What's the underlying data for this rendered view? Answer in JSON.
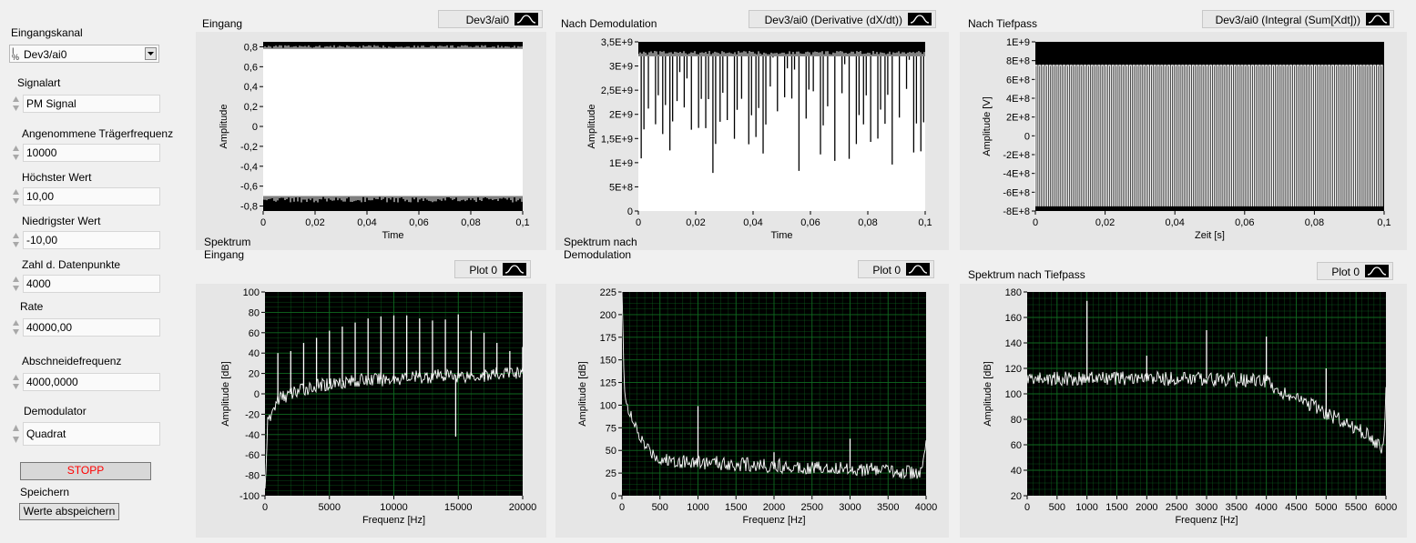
{
  "controls": {
    "channel_label": "Eingangskanal",
    "channel_value": "Dev3/ai0",
    "signal_type_label": "Signalart",
    "signal_type_value": "PM Signal",
    "carrier_label": "Angenommene Trägerfrequenz",
    "carrier_value": "10000",
    "max_label": "Höchster Wert",
    "max_value": "10,00",
    "min_label": "Niedrigster Wert",
    "min_value": "-10,00",
    "points_label": "Zahl d. Datenpunkte",
    "points_value": "4000",
    "rate_label": "Rate",
    "rate_value": "40000,00",
    "cutoff_label": "Abschneidefrequenz",
    "cutoff_value": "4000,0000",
    "demod_label": "Demodulator",
    "demod_value": "Quadrat",
    "stop_label": "STOPP",
    "save_label": "Speichern",
    "save_button": "Werte abspeichern"
  },
  "colors": {
    "plot_bg": "#000000",
    "trace": "#ffffff",
    "grid": "#0f6a20",
    "stop_text": "#ff0000"
  },
  "graphs": [
    {
      "title": "Eingang",
      "legend": "Dev3/ai0",
      "xlabel": "Time",
      "ylabel": "Amplitude",
      "xticks": [
        "0",
        "0,02",
        "0,04",
        "0,06",
        "0,08",
        "0,1"
      ],
      "yticks": [
        "0,8",
        "0,6",
        "0,4",
        "0,2",
        "0",
        "-0,2",
        "-0,4",
        "-0,6",
        "-0,8"
      ],
      "grid": false
    },
    {
      "title": "Nach Demodulation",
      "legend": "Dev3/ai0 (Derivative (dX/dt))",
      "xlabel": "Time",
      "ylabel": "Amplitude",
      "xticks": [
        "0",
        "0,02",
        "0,04",
        "0,06",
        "0,08",
        "0,1"
      ],
      "yticks": [
        "3,5E+9",
        "3E+9",
        "2,5E+9",
        "2E+9",
        "1,5E+9",
        "1E+9",
        "5E+8",
        "0"
      ],
      "grid": false
    },
    {
      "title": "Nach Tiefpass",
      "legend": "Dev3/ai0 (Integral (Sum[Xdt]))",
      "xlabel": "Zeit [s]",
      "ylabel": "Amplitude [V]",
      "xticks": [
        "0",
        "0,02",
        "0,04",
        "0,06",
        "0,08",
        "0,1"
      ],
      "yticks": [
        "1E+9",
        "8E+8",
        "6E+8",
        "4E+8",
        "2E+8",
        "0",
        "-2E+8",
        "-4E+8",
        "-6E+8",
        "-8E+8"
      ],
      "grid": false
    },
    {
      "title": "Spektrum\nEingang",
      "legend": "Plot 0",
      "xlabel": "Frequenz [Hz]",
      "ylabel": "Amplitude [dB]",
      "xticks": [
        "0",
        "5000",
        "10000",
        "15000",
        "20000"
      ],
      "yticks": [
        "100",
        "80",
        "60",
        "40",
        "20",
        "0",
        "-20",
        "-40",
        "-60",
        "-80",
        "-100"
      ],
      "grid": true
    },
    {
      "title": "Spektrum nach\nDemodulation",
      "legend": "Plot 0",
      "xlabel": "Frequenz [Hz]",
      "ylabel": "Amplitude [dB]",
      "xticks": [
        "0",
        "500",
        "1000",
        "1500",
        "2000",
        "2500",
        "3000",
        "3500",
        "4000"
      ],
      "yticks": [
        "225",
        "200",
        "175",
        "150",
        "125",
        "100",
        "75",
        "50",
        "25",
        "0"
      ],
      "grid": true
    },
    {
      "title": "Spektrum nach Tiefpass",
      "legend": "Plot 0",
      "xlabel": "Frequenz [Hz]",
      "ylabel": "Amplitude [dB]",
      "xticks": [
        "0",
        "500",
        "1000",
        "1500",
        "2000",
        "2500",
        "3000",
        "3500",
        "4000",
        "4500",
        "5000",
        "5500",
        "6000"
      ],
      "yticks": [
        "180",
        "160",
        "140",
        "120",
        "100",
        "80",
        "60",
        "40",
        "20"
      ],
      "grid": true
    }
  ],
  "chart_data": [
    {
      "type": "line",
      "title": "Eingang",
      "series": [
        {
          "name": "Dev3/ai0",
          "x_range": [
            0,
            0.1
          ],
          "y_band": [
            -0.7,
            0.78
          ]
        }
      ],
      "xlabel": "Time",
      "ylabel": "Amplitude",
      "xlim": [
        0,
        0.1
      ],
      "ylim": [
        -0.85,
        0.85
      ]
    },
    {
      "type": "line",
      "title": "Nach Demodulation",
      "series": [
        {
          "name": "Dev3/ai0 (Derivative (dX/dt))",
          "x_range": [
            0,
            0.1
          ],
          "y_band": [
            0,
            3200000000.0
          ],
          "notches_per_0_1s": 40,
          "notch_depth": [
            750000000.0,
            2600000000.0
          ]
        }
      ],
      "xlabel": "Time",
      "ylabel": "Amplitude",
      "xlim": [
        0,
        0.1
      ],
      "ylim": [
        0,
        3500000000.0
      ]
    },
    {
      "type": "line",
      "title": "Nach Tiefpass",
      "series": [
        {
          "name": "Dev3/ai0 (Integral (Sum[Xdt]))",
          "x_range": [
            0,
            0.1
          ],
          "y_band": [
            -750000000.0,
            750000000.0
          ],
          "cycles": 100
        }
      ],
      "xlabel": "Zeit [s]",
      "ylabel": "Amplitude [V]",
      "xlim": [
        0,
        0.1
      ],
      "ylim": [
        -800000000.0,
        1000000000.0
      ]
    },
    {
      "type": "line",
      "title": "Spektrum Eingang",
      "series": [
        {
          "name": "Plot 0",
          "baseline": [
            [
              0,
              -95
            ],
            [
              200,
              -30
            ],
            [
              1000,
              -5
            ],
            [
              3000,
              5
            ],
            [
              6000,
              12
            ],
            [
              10000,
              15
            ],
            [
              14000,
              18
            ],
            [
              17000,
              18
            ],
            [
              20000,
              22
            ]
          ],
          "peaks": [
            [
              1000,
              40
            ],
            [
              2000,
              42
            ],
            [
              3000,
              50
            ],
            [
              4000,
              55
            ],
            [
              5000,
              62
            ],
            [
              6000,
              66
            ],
            [
              7000,
              70
            ],
            [
              8000,
              74
            ],
            [
              9000,
              76
            ],
            [
              10000,
              77
            ],
            [
              11000,
              77
            ],
            [
              12000,
              74
            ],
            [
              13000,
              72
            ],
            [
              14000,
              73
            ],
            [
              15000,
              78
            ],
            [
              16000,
              62
            ],
            [
              17000,
              60
            ],
            [
              18000,
              50
            ],
            [
              19000,
              42
            ],
            [
              20000,
              46
            ]
          ],
          "dips": [
            [
              14800,
              -42
            ]
          ]
        }
      ],
      "xlabel": "Frequenz [Hz]",
      "ylabel": "Amplitude [dB]",
      "xlim": [
        0,
        20000
      ],
      "ylim": [
        -100,
        100
      ]
    },
    {
      "type": "line",
      "title": "Spektrum nach Demodulation",
      "series": [
        {
          "name": "Plot 0",
          "baseline": [
            [
              0,
              225
            ],
            [
              30,
              120
            ],
            [
              100,
              90
            ],
            [
              200,
              70
            ],
            [
              300,
              55
            ],
            [
              500,
              40
            ],
            [
              1000,
              37
            ],
            [
              2000,
              33
            ],
            [
              3000,
              30
            ],
            [
              3950,
              25
            ],
            [
              4000,
              60
            ]
          ],
          "peaks": [
            [
              1000,
              99
            ],
            [
              2000,
              48
            ],
            [
              3000,
              63
            ]
          ]
        }
      ],
      "xlabel": "Frequenz [Hz]",
      "ylabel": "Amplitude [dB]",
      "xlim": [
        0,
        4000
      ],
      "ylim": [
        0,
        225
      ]
    },
    {
      "type": "line",
      "title": "Spektrum nach Tiefpass",
      "series": [
        {
          "name": "Plot 0",
          "baseline": [
            [
              0,
              112
            ],
            [
              1000,
              112
            ],
            [
              2000,
              112
            ],
            [
              3000,
              112
            ],
            [
              4000,
              110
            ],
            [
              4300,
              100
            ],
            [
              4700,
              92
            ],
            [
              5000,
              85
            ],
            [
              5300,
              78
            ],
            [
              5700,
              68
            ],
            [
              5950,
              55
            ],
            [
              6000,
              100
            ]
          ],
          "peaks": [
            [
              1000,
              173
            ],
            [
              2000,
              130
            ],
            [
              3000,
              150
            ],
            [
              4000,
              145
            ],
            [
              5000,
              120
            ]
          ]
        }
      ],
      "xlabel": "Frequenz [Hz]",
      "ylabel": "Amplitude [dB]",
      "xlim": [
        0,
        6000
      ],
      "ylim": [
        20,
        180
      ]
    }
  ]
}
